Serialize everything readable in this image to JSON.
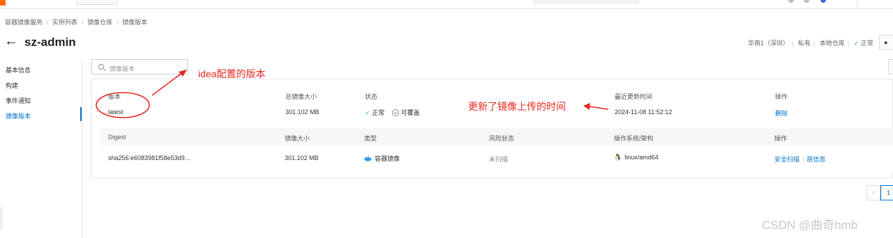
{
  "breadcrumb": [
    "容器镜像服务",
    "实例列表",
    "镜像仓库",
    "镜像版本"
  ],
  "page_title": "sz-admin",
  "meta": {
    "region": "华南1（深圳）",
    "visibility": "私有",
    "repo_type": "本地仓库",
    "status": "正常"
  },
  "sidebar": {
    "items": [
      {
        "label": "基本信息",
        "active": false
      },
      {
        "label": "构建",
        "active": false
      },
      {
        "label": "事件通知",
        "active": false
      },
      {
        "label": "镜像版本",
        "active": true
      }
    ]
  },
  "search": {
    "placeholder": "镜像版本"
  },
  "version_table": {
    "headers": {
      "version": "版本",
      "total_size": "总镜像大小",
      "status": "状态",
      "updated": "最近更新时间",
      "actions": "操作"
    },
    "row": {
      "version": "latest",
      "total_size": "301.102 MB",
      "status": "正常",
      "overwrite": "可覆盖",
      "updated": "2024-11-08 11:52:12",
      "delete_label": "删除"
    }
  },
  "digest_table": {
    "headers": {
      "digest": "Digest",
      "size": "镜像大小",
      "type": "类型",
      "risk": "风险状态",
      "os_arch": "操作系统/架构",
      "actions": "操作"
    },
    "row": {
      "digest": "sha256:e6083981f58e53d9...",
      "size": "301.102 MB",
      "type": "容器镜像",
      "risk": "未扫描",
      "os_arch": "linux/amd64",
      "scan_label": "安全扫描",
      "layer_label": "层信息"
    }
  },
  "pagination": {
    "current": "1"
  },
  "annotations": {
    "version_note": "idea配置的版本",
    "time_note": "更新了镜像上传的时间"
  },
  "watermark": "CSDN @曲奇hmb",
  "colors": {
    "accent": "#0070cc",
    "annotation": "#e8281f",
    "ok": "#2db84d",
    "brand": "#ff6a00"
  }
}
